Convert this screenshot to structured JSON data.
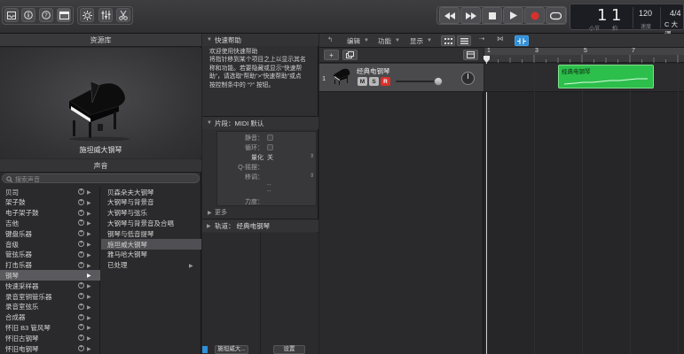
{
  "toolbar": {
    "left_icons": [
      "inbox-icon",
      "info-icon",
      "help-icon",
      "media-browser-icon",
      "smart-controls-icon",
      "mixer-icon",
      "scissors-icon"
    ],
    "transport": [
      "rewind-icon",
      "fast-forward-icon",
      "stop-icon",
      "play-icon",
      "record-icon",
      "cycle-icon"
    ],
    "lcd": {
      "bar": "1",
      "beat": "1",
      "bar_caption": "小节",
      "beat_caption": "拍",
      "tempo": "120",
      "tempo_caption": "速度",
      "time_sig": "4/4",
      "key": "C 大调"
    },
    "colors": {
      "record": "#d9302b",
      "accent": "#2f8fd8"
    }
  },
  "library": {
    "title": "资源库",
    "instrument_name": "施坦威大钢琴",
    "sound_header": "声音",
    "search_placeholder": "搜索声音",
    "categories": [
      {
        "label": "贝司"
      },
      {
        "label": "架子鼓"
      },
      {
        "label": "电子架子鼓"
      },
      {
        "label": "吉他"
      },
      {
        "label": "键盘乐器"
      },
      {
        "label": "音级"
      },
      {
        "label": "管弦乐器"
      },
      {
        "label": "打击乐器"
      },
      {
        "label": "钢琴"
      },
      {
        "label": "快速采样器"
      },
      {
        "label": "录音室铜管乐器"
      },
      {
        "label": "录音室弦乐"
      },
      {
        "label": "合成器"
      },
      {
        "label": "怀旧 B3 管风琴"
      },
      {
        "label": "怀旧古钢琴"
      },
      {
        "label": "怀旧电钢琴"
      }
    ],
    "selected_category": "钢琴",
    "patches": [
      {
        "label": "贝森朵夫大钢琴"
      },
      {
        "label": "大钢琴与背景音"
      },
      {
        "label": "大钢琴与弦乐"
      },
      {
        "label": "大钢琴与背景音及合唱"
      },
      {
        "label": "钢琴与低音提琴"
      },
      {
        "label": "施坦威大钢琴"
      },
      {
        "label": "雅马哈大钢琴"
      },
      {
        "label": "已处理"
      }
    ],
    "selected_patch": "施坦威大钢琴"
  },
  "quickhelp": {
    "title": "快速帮助",
    "text_lines": [
      "欢迎使用快速帮助",
      "将指针移到某个项目之上以显示其名",
      "称和功能。若要隐藏或显示“快速帮",
      "助”，请选取“帮助”>“快速帮助”或点",
      "按控制条中的 “?” 按钮。"
    ]
  },
  "inspector": {
    "region_title": "片段：MIDI 默认",
    "fields": {
      "mute": "静音：",
      "loop": "循环：",
      "quantize": "量化",
      "quantize_value": "关",
      "q_swing": "Q-摇摆：",
      "transpose": "移调：",
      "velocity": "力度："
    },
    "more": "更多",
    "track_title": "轨道：  经典电钢琴",
    "bottom_left_label": "施坦威大...",
    "bottom_right_label": "设置"
  },
  "tracks": {
    "menus": {
      "edit": "编辑",
      "functions": "功能",
      "view": "显示"
    },
    "ruler": [
      "1",
      "3",
      "5",
      "7"
    ],
    "track": {
      "number": "1",
      "name": "经典电钢琴",
      "mute": "M",
      "solo": "S",
      "record": "R"
    },
    "region": {
      "name": "经典电钢琴",
      "color": "#2dbf4b"
    }
  }
}
